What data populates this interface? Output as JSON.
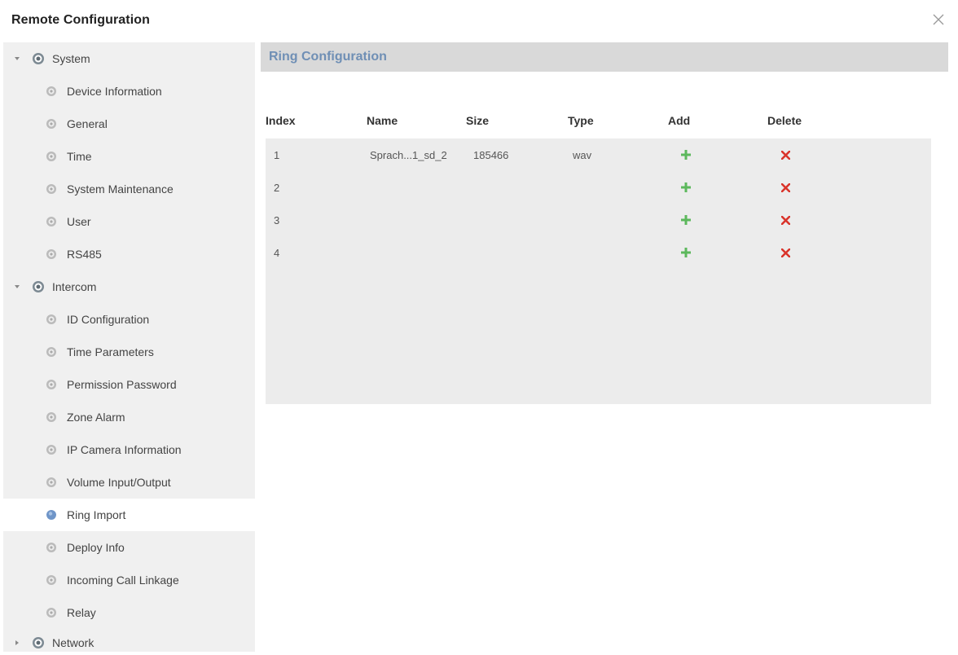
{
  "window": {
    "title": "Remote Configuration"
  },
  "icons": {
    "close": "close-icon",
    "group": "gear-icon",
    "item": "gear-icon",
    "selected": "radio-dot-icon",
    "add": "plus-icon",
    "delete": "x-icon"
  },
  "colors": {
    "add": "#5cb85c",
    "delete": "#d9342b",
    "header_text": "#6f8fb5",
    "sidebar_bg": "#f0f0f0"
  },
  "sidebar": {
    "system": {
      "label": "System",
      "expanded": true,
      "items": [
        "Device Information",
        "General",
        "Time",
        "System Maintenance",
        "User",
        "RS485"
      ]
    },
    "intercom": {
      "label": "Intercom",
      "expanded": true,
      "items": [
        "ID Configuration",
        "Time Parameters",
        "Permission Password",
        "Zone Alarm",
        "IP Camera Information",
        "Volume Input/Output",
        "Ring Import",
        "Deploy Info",
        "Incoming Call Linkage",
        "Relay"
      ]
    },
    "network": {
      "label": "Network",
      "expanded": false
    },
    "selected": "Ring Import"
  },
  "main": {
    "title": "Ring Configuration",
    "columns": {
      "index": "Index",
      "name": "Name",
      "size": "Size",
      "type": "Type",
      "add": "Add",
      "delete": "Delete"
    },
    "rows": [
      {
        "index": "1",
        "name": "Sprach...1_sd_2",
        "size": "185466",
        "type": "wav"
      },
      {
        "index": "2",
        "name": "",
        "size": "",
        "type": ""
      },
      {
        "index": "3",
        "name": "",
        "size": "",
        "type": ""
      },
      {
        "index": "4",
        "name": "",
        "size": "",
        "type": ""
      }
    ]
  }
}
